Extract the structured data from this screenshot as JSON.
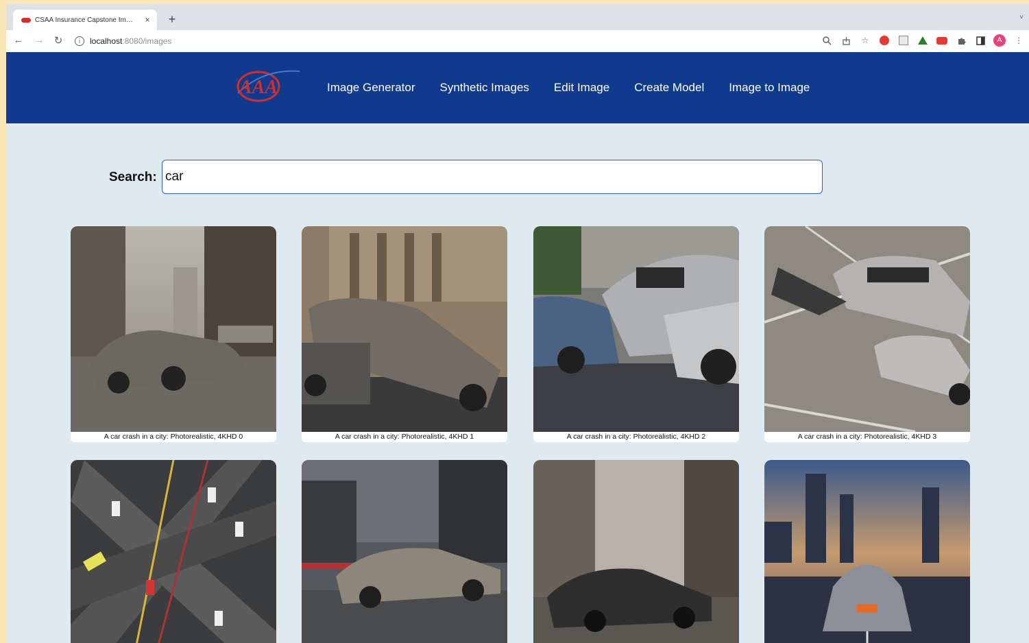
{
  "browser": {
    "tab_title": "CSAA Insurance Capstone Im…",
    "tab_close": "×",
    "new_tab": "+",
    "tab_menu": "˅",
    "url_host": "localhost",
    "url_path": ":8080/images",
    "nav_back": "←",
    "nav_forward": "→",
    "nav_reload": "↻",
    "info_icon": "i",
    "toolbar_icons": [
      "zoom-icon",
      "share-icon",
      "bookmark-star-icon",
      "extension-icons",
      "puzzle-icon",
      "sidebar-icon",
      "profile-icon",
      "kebab-menu-icon"
    ],
    "profile_initial": "A"
  },
  "header": {
    "logo_text": "AAA",
    "nav": [
      "Image Generator",
      "Synthetic Images",
      "Edit Image",
      "Create Model",
      "Image to Image"
    ]
  },
  "search": {
    "label": "Search:",
    "value": "car"
  },
  "gallery": {
    "images": [
      {
        "caption": "A car crash in a city: Photorealistic, 4KHD 0",
        "scene": "foggy-street"
      },
      {
        "caption": "A car crash in a city: Photorealistic, 4KHD 1",
        "scene": "overturned-car"
      },
      {
        "caption": "A car crash in a city: Photorealistic, 4KHD 2",
        "scene": "pileup"
      },
      {
        "caption": "A car crash in a city: Photorealistic, 4KHD 3",
        "scene": "road-debris"
      },
      {
        "caption": "",
        "scene": "highway-aerial"
      },
      {
        "caption": "",
        "scene": "stormy-street"
      },
      {
        "caption": "",
        "scene": "hazy-avenue"
      },
      {
        "caption": "",
        "scene": "sunset-skyline"
      }
    ]
  },
  "colors": {
    "header_bg": "#0f3a8e",
    "page_bg": "#dfeaf0",
    "brand_red": "#d22d2d",
    "outer_bg": "#fbe6b8"
  }
}
